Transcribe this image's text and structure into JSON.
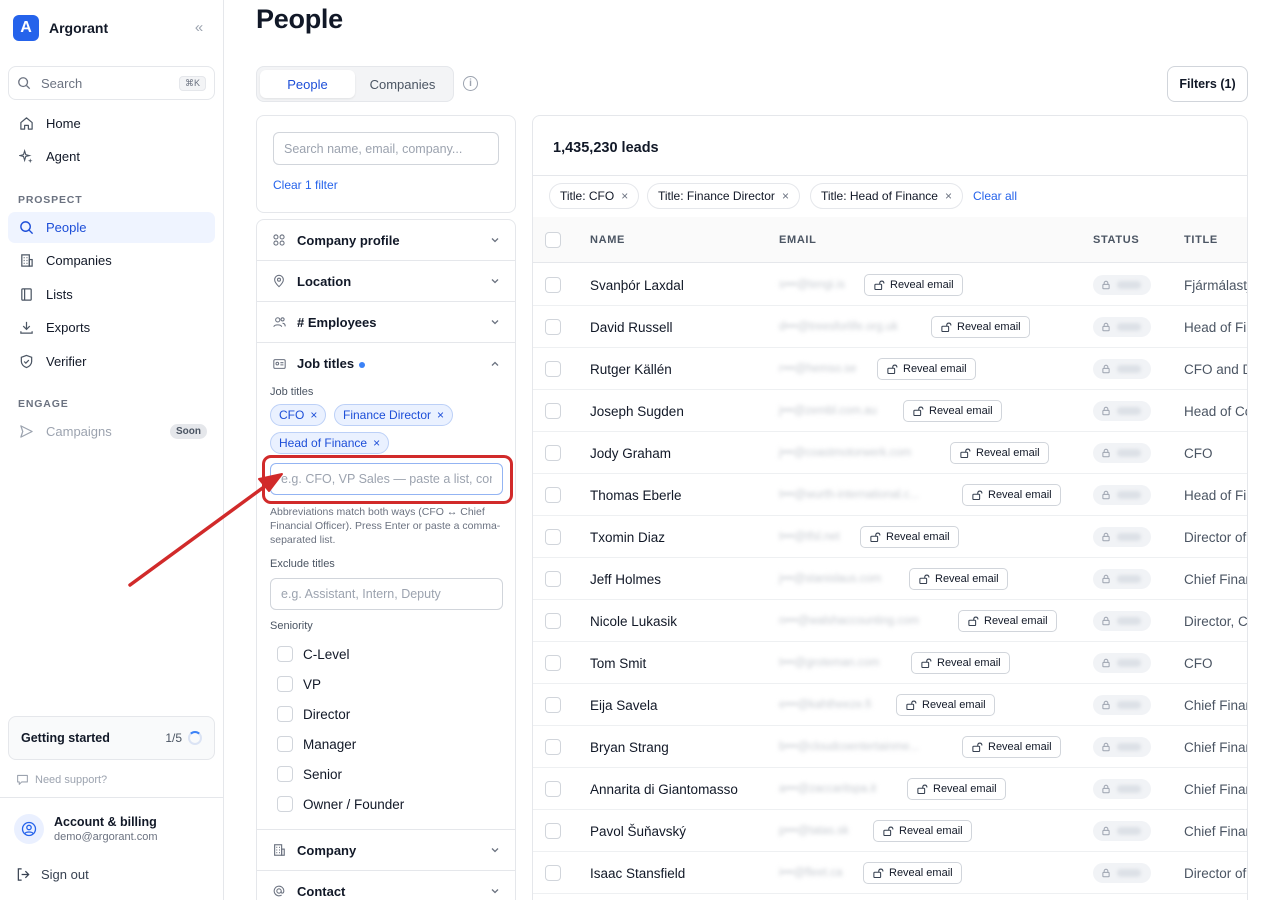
{
  "sidebar": {
    "brand": "Argorant",
    "search_label": "Search",
    "search_shortcut": "⌘K",
    "items": [
      {
        "label": "Home",
        "icon": "home-icon"
      },
      {
        "label": "Agent",
        "icon": "sparkles-icon"
      }
    ],
    "prospect_label": "PROSPECT",
    "prospect_items": [
      {
        "label": "People",
        "icon": "search-icon",
        "active": true
      },
      {
        "label": "Companies",
        "icon": "building-icon"
      },
      {
        "label": "Lists",
        "icon": "book-icon"
      },
      {
        "label": "Exports",
        "icon": "download-icon"
      },
      {
        "label": "Verifier",
        "icon": "shield-check-icon"
      }
    ],
    "engage_label": "ENGAGE",
    "engage_items": [
      {
        "label": "Campaigns",
        "icon": "send-icon",
        "badge": "Soon",
        "disabled": true
      }
    ],
    "getting_started": {
      "label": "Getting started",
      "progress": "1/5"
    },
    "support": "Need support?",
    "account": {
      "title": "Account & billing",
      "email": "demo@argorant.com"
    },
    "signout": "Sign out"
  },
  "header": {
    "title": "People",
    "tabs": [
      {
        "label": "People",
        "active": true
      },
      {
        "label": "Companies"
      }
    ],
    "filters_button": "Filters (1)"
  },
  "filter_panel": {
    "search_placeholder": "Search name, email, company...",
    "clear_filter": "Clear 1 filter",
    "sections": {
      "company_profile": "Company profile",
      "location": "Location",
      "employees": "# Employees",
      "job_titles": "Job titles",
      "company": "Company",
      "contact": "Contact"
    },
    "job_titles_label": "Job titles",
    "selected_titles": [
      "CFO",
      "Finance Director",
      "Head of Finance"
    ],
    "title_input_placeholder": "e.g. CFO, VP Sales — paste a list, comma-separated",
    "hint": "Abbreviations match both ways (CFO ↔ Chief Financial Officer). Press Enter or paste a comma-separated list.",
    "exclude_label": "Exclude titles",
    "exclude_placeholder": "e.g. Assistant, Intern, Deputy",
    "seniority_label": "Seniority",
    "seniority": [
      "C-Level",
      "VP",
      "Director",
      "Manager",
      "Senior",
      "Owner / Founder"
    ]
  },
  "table": {
    "count": "1,435,230 leads",
    "active_filters": [
      "Title: CFO",
      "Title: Finance Director",
      "Title: Head of Finance"
    ],
    "clear_all": "Clear all",
    "columns": {
      "name": "NAME",
      "email": "EMAIL",
      "status": "STATUS",
      "title": "TITLE"
    },
    "reveal_label": "Reveal email",
    "rows": [
      {
        "name": "Svanþór Laxdal",
        "email": "s•••@tengi.is",
        "title": "Fjármálastjóri"
      },
      {
        "name": "David Russell",
        "email": "d•••@treesforlife.org.uk",
        "title": "Head of Finance"
      },
      {
        "name": "Rutger Källén",
        "email": "r•••@hemso.se",
        "title": "CFO and Deputy CEO"
      },
      {
        "name": "Joseph Sugden",
        "email": "j•••@zembl.com.au",
        "title": "Head of Commercial"
      },
      {
        "name": "Jody Graham",
        "email": "j•••@coastmotorwerk.com",
        "title": "CFO"
      },
      {
        "name": "Thomas Eberle",
        "email": "t•••@wurth-international.c...",
        "title": "Head of Finance"
      },
      {
        "name": "Txomin Diaz",
        "email": "t•••@tfsl.net",
        "title": "Director of Finance"
      },
      {
        "name": "Jeff Holmes",
        "email": "j•••@stanislaus.com",
        "title": "Chief Financial Officer"
      },
      {
        "name": "Nicole Lukasik",
        "email": "n•••@walshaccounting.com",
        "title": "Director, Client Services"
      },
      {
        "name": "Tom Smit",
        "email": "t•••@groteman.com",
        "title": "CFO"
      },
      {
        "name": "Eija Savela",
        "email": "e•••@kahtheeze.fi",
        "title": "Chief Financial Officer"
      },
      {
        "name": "Bryan Strang",
        "email": "b•••@cloudcoentertainme...",
        "title": "Chief Financial Officer"
      },
      {
        "name": "Annarita di Giantomasso",
        "email": "a•••@zaccaritspa.it",
        "title": "Chief Financial Officer"
      },
      {
        "name": "Pavol Šuňavský",
        "email": "p•••@tatas.sk",
        "title": "Chief Financial Officer"
      },
      {
        "name": "Isaac Stansfield",
        "email": "i•••@fleet.ca",
        "title": "Director of Finance"
      }
    ]
  },
  "colors": {
    "accent": "#2563eb",
    "annotation": "#d12a2a"
  }
}
